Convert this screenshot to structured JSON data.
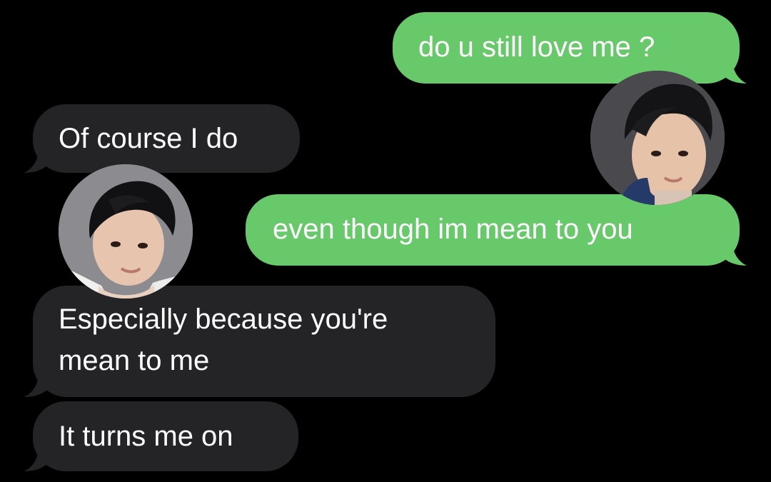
{
  "conversation": {
    "messages": [
      {
        "side": "sent",
        "text": "do u still love me ?"
      },
      {
        "side": "received",
        "text": "Of course I do"
      },
      {
        "side": "sent",
        "text": "even though im mean to you"
      },
      {
        "side": "received",
        "line1": "Especially because you're",
        "line2": "mean to me"
      },
      {
        "side": "received",
        "text": "It turns me on"
      }
    ]
  },
  "colors": {
    "background": "#000000",
    "sent_bubble": "#67c96a",
    "received_bubble": "#242427",
    "text": "#ffffff"
  },
  "avatars": [
    {
      "name": "sender-avatar",
      "icon": "person-photo-icon"
    },
    {
      "name": "recipient-avatar",
      "icon": "person-photo-icon"
    }
  ]
}
